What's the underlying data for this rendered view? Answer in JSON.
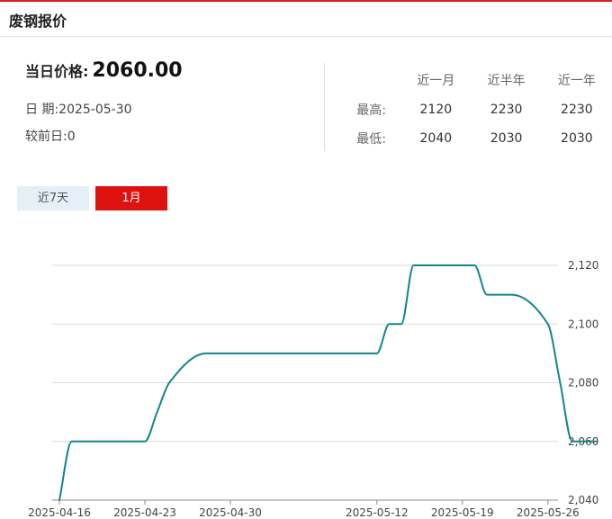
{
  "header": {
    "title": "废钢报价"
  },
  "summary": {
    "today_label": "当日价格:",
    "today_value": "2060.00",
    "date_text": "日 期:2025-05-30",
    "change_text": "较前日:0"
  },
  "stats": {
    "columns": [
      "近一月",
      "近半年",
      "近一年"
    ],
    "rows": [
      {
        "label": "最高:",
        "values": [
          "2120",
          "2230",
          "2230"
        ]
      },
      {
        "label": "最低:",
        "values": [
          "2040",
          "2030",
          "2030"
        ]
      }
    ]
  },
  "tabs": [
    {
      "label": "近7天",
      "active": false
    },
    {
      "label": "1月",
      "active": true
    }
  ],
  "colors": {
    "accent": "#df1111",
    "line": "#13868a",
    "grid": "#d9d9d9",
    "tab_inactive_bg": "#e6eef8"
  },
  "chart_data": {
    "type": "line",
    "title": "",
    "xlabel": "",
    "ylabel": "",
    "ylim": [
      2040,
      2120
    ],
    "yticks": [
      2040,
      2060,
      2080,
      2100,
      2120
    ],
    "ytick_labels": [
      "2,040",
      "2,060",
      "2,080",
      "2,100",
      "2,120"
    ],
    "xticks": [
      "2025-04-16",
      "2025-04-23",
      "2025-04-30",
      "2025-05-12",
      "2025-05-19",
      "2025-05-26"
    ],
    "grid": true,
    "series": [
      {
        "x": [
          "2025-04-16",
          "2025-04-17",
          "2025-04-18",
          "2025-04-21",
          "2025-04-22",
          "2025-04-23",
          "2025-04-24",
          "2025-04-25",
          "2025-04-28",
          "2025-04-29",
          "2025-04-30",
          "2025-05-06",
          "2025-05-07",
          "2025-05-08",
          "2025-05-09",
          "2025-05-12",
          "2025-05-13",
          "2025-05-14",
          "2025-05-15",
          "2025-05-16",
          "2025-05-19",
          "2025-05-20",
          "2025-05-21",
          "2025-05-22",
          "2025-05-23",
          "2025-05-26",
          "2025-05-27",
          "2025-05-28",
          "2025-05-29",
          "2025-05-30"
        ],
        "values": [
          2040,
          2060,
          2060,
          2060,
          2060,
          2060,
          2070,
          2080,
          2090,
          2090,
          2090,
          2090,
          2090,
          2090,
          2090,
          2090,
          2100,
          2100,
          2120,
          2120,
          2120,
          2120,
          2110,
          2110,
          2110,
          2100,
          2080,
          2060,
          2060,
          2060
        ]
      }
    ]
  }
}
